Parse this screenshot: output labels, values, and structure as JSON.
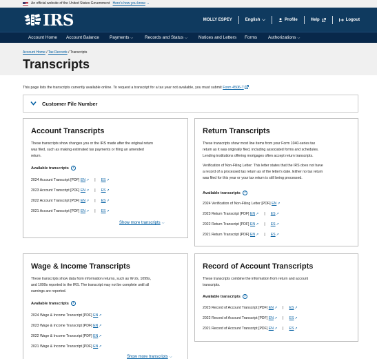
{
  "gov_banner": {
    "text": "An official website of the United States Government",
    "link": "Here's how you know"
  },
  "header": {
    "logo": "IRS",
    "user": "MOLLY ESPEY",
    "language": "English",
    "profile": "Profile",
    "help": "Help",
    "logout": "Logout"
  },
  "nav": {
    "items": [
      "Account Home",
      "Account Balance",
      "Payments",
      "Records and Status",
      "Notices and Letters",
      "Forms",
      "Authorizations"
    ]
  },
  "breadcrumb": {
    "home": "Account Home",
    "sep": "/",
    "records": "Tax Records",
    "current": "Transcripts"
  },
  "page_title": "Transcripts",
  "intro": {
    "text": "This page lists the transcripts currently available online. To request a transcript for a tax year not available, you must submit",
    "link": "Form 4506-T",
    "end": "."
  },
  "customer_file": "Customer File Number",
  "available_label": "Available transcripts",
  "en": "EN",
  "es": "ES",
  "pipe": "|",
  "account": {
    "title": "Account Transcripts",
    "desc": [
      "These transcripts show changes you or the IRS made after the original return",
      "was filed, such as making estimated tax payments or filing an amended",
      "return."
    ],
    "rows": [
      "2024 Account Transcript [PDF]",
      "2023 Account Transcript [PDF]",
      "2022 Account Transcript [PDF]",
      "2021 Account Transcript [PDF]"
    ],
    "more": "Show more transcripts"
  },
  "return": {
    "title": "Return Transcripts",
    "desc": [
      "These transcripts show most line items from your Form 1040-series tax",
      "return as it was originally filed, including associated forms and schedules.",
      "Lending institutions offering mortgages often accept return transcripts."
    ],
    "desc2": [
      "Verification of Non-Filing Letter: This letter states that the IRS does not have",
      "a record of a processed tax return as of the letter's date. Either no tax return",
      "was filed for this year or your tax return is still being processed."
    ],
    "rows": [
      "2024 Verification of Non-Filing Letter [PDF]",
      "2023 Return Transcript [PDF]",
      "2022 Return Transcript [PDF]",
      "2021 Return Transcript [PDF]"
    ]
  },
  "wage": {
    "title": "Wage & Income Transcripts",
    "desc": [
      "These transcripts show data from information returns, such as W-2s, 1099s,",
      "and 1099s reported to the IRS. The transcript may not be complete until all",
      "earnings are reported."
    ],
    "rows": [
      "2024 Wage & Income Transcript [PDF]",
      "2023 Wage & Income Transcript [PDF]",
      "2022 Wage & Income Transcript [PDF]",
      "2021 Wage & Income Transcript [PDF]"
    ],
    "more": "Show more transcripts"
  },
  "record": {
    "title": "Record of Account Transcripts",
    "desc": [
      "These transcripts combine the information from return and account",
      "transcripts."
    ],
    "rows": [
      "2023 Record of Account Transcript [PDF]",
      "2022 Record of Account Transcript [PDF]",
      "2021 Record of Account Transcript [PDF]"
    ]
  }
}
